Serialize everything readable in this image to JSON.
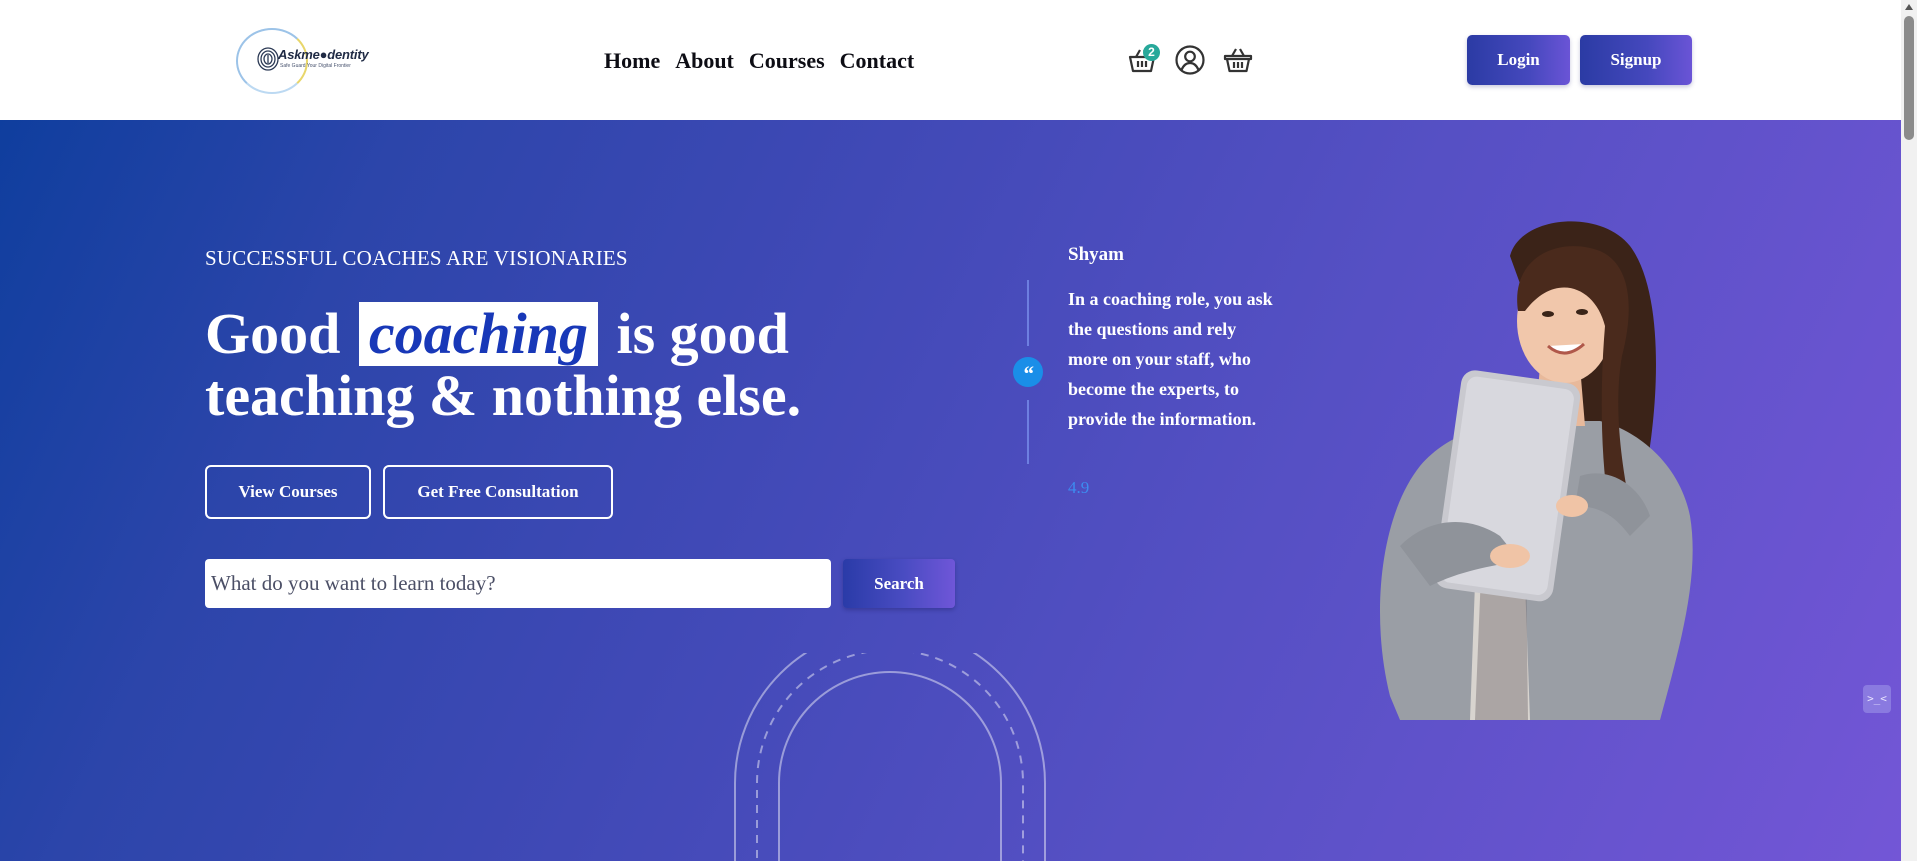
{
  "header": {
    "logo": {
      "name": "Askme Identity",
      "brand_text": "Askme●dentity",
      "tagline": "Safe Guard Your Digital Frontier"
    },
    "nav": [
      "Home",
      "About",
      "Courses",
      "Contact"
    ],
    "icons": {
      "cart": {
        "icon": "cart-icon",
        "badge": "2"
      },
      "user": {
        "icon": "user-icon"
      },
      "basket": {
        "icon": "basket-icon"
      }
    },
    "login_label": "Login",
    "signup_label": "Signup"
  },
  "hero": {
    "eyebrow": "SUCCESSFUL COACHES ARE VISIONARIES",
    "headline": {
      "part1": "Good",
      "highlight": "coaching",
      "part2": "is good",
      "line2": "teaching & nothing else."
    },
    "view_courses_label": "View Courses",
    "consultation_label": "Get Free Consultation",
    "search": {
      "placeholder": "What do you want to learn today?",
      "button_label": "Search"
    },
    "testimonial": {
      "quote_mark": "“",
      "name": "Shyam",
      "text": "In a coaching role, you ask the questions and rely more on your staff, who become the experts, to provide the information.",
      "rating": "4.9"
    }
  },
  "chat_widget": {
    "label": ">_<"
  },
  "colors": {
    "hero_start": "#0f3e9e",
    "hero_end": "#7356d6",
    "highlight_text": "#1838b8",
    "badge": "#27a89a",
    "quote_dot": "#1a8ee8",
    "rating": "#3d8cf0"
  }
}
